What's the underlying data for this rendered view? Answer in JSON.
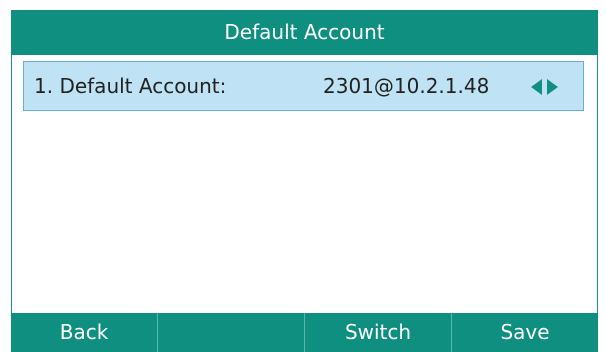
{
  "header": {
    "title": "Default Account"
  },
  "rows": [
    {
      "label": "1. Default Account:",
      "value": "2301@10.2.1.48"
    }
  ],
  "softkeys": [
    {
      "label": "Back"
    },
    {
      "label": ""
    },
    {
      "label": "Switch"
    },
    {
      "label": "Save"
    }
  ],
  "colors": {
    "title_bar": "#0f8f80",
    "selected_row": "#bfe3f4",
    "selected_row_border": "#6aaed6",
    "arrow": "#0f8f80"
  },
  "icons": {
    "left": "triangle-left-icon",
    "right": "triangle-right-icon"
  }
}
